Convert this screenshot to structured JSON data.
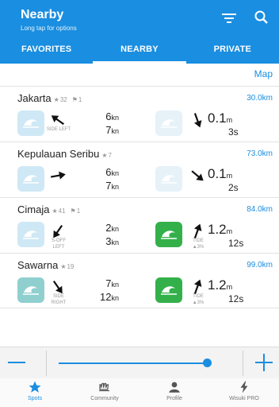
{
  "header": {
    "title": "Nearby",
    "subtitle": "Long tap for options",
    "tabs": [
      {
        "label": "FAVORITES"
      },
      {
        "label": "NEARBY"
      },
      {
        "label": "PRIVATE"
      }
    ]
  },
  "map_link": "Map",
  "spots": [
    {
      "name": "Jakarta",
      "rating": "32",
      "count": "1",
      "distance": "30.0km",
      "wind_sub": "SIDE LEFT",
      "wind_speed": "6",
      "wind_gust": "7",
      "unit": "kn",
      "wave_height": "0.1",
      "wave_unit": "m",
      "wave_period": "3s",
      "tide_label": "",
      "tide_pct": ""
    },
    {
      "name": "Kepulauan Seribu",
      "rating": "7",
      "count": "",
      "distance": "73.0km",
      "wind_sub": "",
      "wind_speed": "6",
      "wind_gust": "7",
      "unit": "kn",
      "wave_height": "0.1",
      "wave_unit": "m",
      "wave_period": "2s",
      "tide_label": "",
      "tide_pct": ""
    },
    {
      "name": "Cimaja",
      "rating": "41",
      "count": "1",
      "distance": "84.0km",
      "wind_sub": "S-OFF LEFT",
      "wind_speed": "2",
      "wind_gust": "3",
      "unit": "kn",
      "wave_height": "1.2",
      "wave_unit": "m",
      "wave_period": "12s",
      "tide_label": "TIDE",
      "tide_pct": "▲3%"
    },
    {
      "name": "Sawarna",
      "rating": "19",
      "count": "",
      "distance": "99.0km",
      "wind_sub": "SIDE RIGHT",
      "wind_speed": "7",
      "wind_gust": "12",
      "unit": "kn",
      "wave_height": "1.2",
      "wave_unit": "m",
      "wave_period": "12s",
      "tide_label": "TIDE",
      "tide_pct": "▲3%"
    }
  ],
  "bottom_nav": [
    {
      "label": "Spots",
      "icon": "star-icon"
    },
    {
      "label": "Community",
      "icon": "hand-icon"
    },
    {
      "label": "Profile",
      "icon": "person-icon"
    },
    {
      "label": "Wisuki PRO",
      "icon": "bolt-icon"
    }
  ],
  "colors": {
    "accent": "#1a8ee0",
    "good": "#33b04a"
  }
}
